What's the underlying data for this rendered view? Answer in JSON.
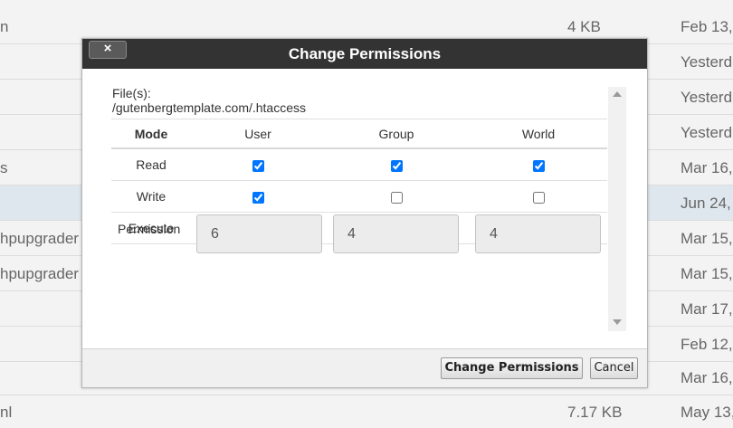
{
  "background_rows": [
    {
      "name": "n",
      "size": "4 KB",
      "date": "Feb 13,",
      "selected": false
    },
    {
      "name": "",
      "size": "",
      "date": "Yesterd",
      "selected": false
    },
    {
      "name": "",
      "size": "",
      "date": "Yesterd",
      "selected": false
    },
    {
      "name": "",
      "size": "",
      "date": "Yesterd",
      "selected": false
    },
    {
      "name": "s",
      "size": "",
      "date": "Mar 16,",
      "selected": false
    },
    {
      "name": "",
      "size": "",
      "date": "Jun 24,",
      "selected": true
    },
    {
      "name": "hpupgrader",
      "size": "",
      "date": "Mar 15,",
      "selected": false
    },
    {
      "name": "hpupgrader",
      "size": "",
      "date": "Mar 15,",
      "selected": false
    },
    {
      "name": "",
      "size": "",
      "date": "Mar 17,",
      "selected": false
    },
    {
      "name": "",
      "size": "",
      "date": "Feb 12,",
      "selected": false
    },
    {
      "name": "",
      "size": "",
      "date": "Mar 16,",
      "selected": false
    },
    {
      "name": "nl",
      "size": "7.17 KB",
      "date": "May 13,",
      "selected": false
    }
  ],
  "dialog": {
    "title": "Change Permissions",
    "close_label": "×",
    "files_label": "File(s):",
    "files_path": "/gutenbergtemplate.com/.htaccess",
    "columns": [
      "Mode",
      "User",
      "Group",
      "World"
    ],
    "rows": [
      {
        "mode": "Read",
        "user": true,
        "group": true,
        "world": true
      },
      {
        "mode": "Write",
        "user": true,
        "group": false,
        "world": false
      },
      {
        "mode": "Execute",
        "user": false,
        "group": false,
        "world": false
      }
    ],
    "permission_label": "Permission",
    "permission_values": [
      "6",
      "4",
      "4"
    ],
    "apply_label": "Change Permissions",
    "cancel_label": "Cancel"
  }
}
